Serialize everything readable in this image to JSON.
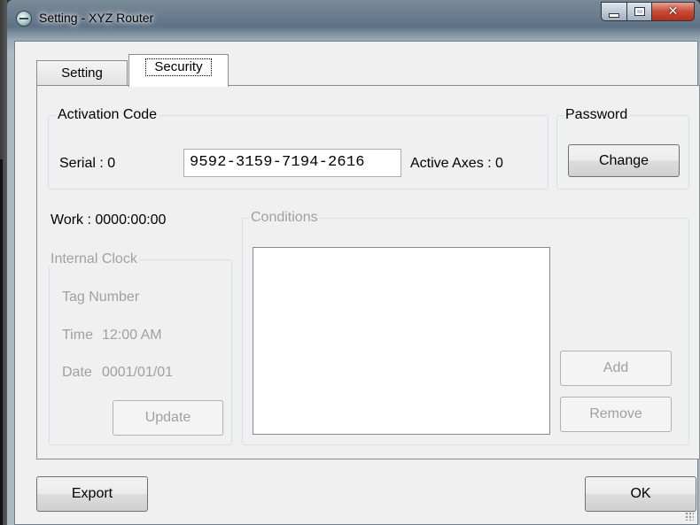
{
  "window": {
    "title": "Setting - XYZ Router"
  },
  "tabs": [
    {
      "label": "Setting"
    },
    {
      "label": "Security"
    }
  ],
  "activation": {
    "group_label": "Activation Code",
    "serial_label": "Serial : 0",
    "serial_value": "9592-3159-7194-2616",
    "active_axes_label": "Active Axes : 0"
  },
  "password": {
    "group_label": "Password",
    "change_label": "Change"
  },
  "work_label": "Work : 0000:00:00",
  "internal_clock": {
    "group_label": "Internal Clock",
    "tag_number_label": "Tag Number",
    "time_label": "Time",
    "time_value": "12:00 AM",
    "date_label": "Date",
    "date_value": "0001/01/01",
    "update_label": "Update"
  },
  "conditions": {
    "group_label": "Conditions",
    "add_label": "Add",
    "remove_label": "Remove",
    "items": []
  },
  "footer": {
    "export_label": "Export",
    "ok_label": "OK"
  }
}
